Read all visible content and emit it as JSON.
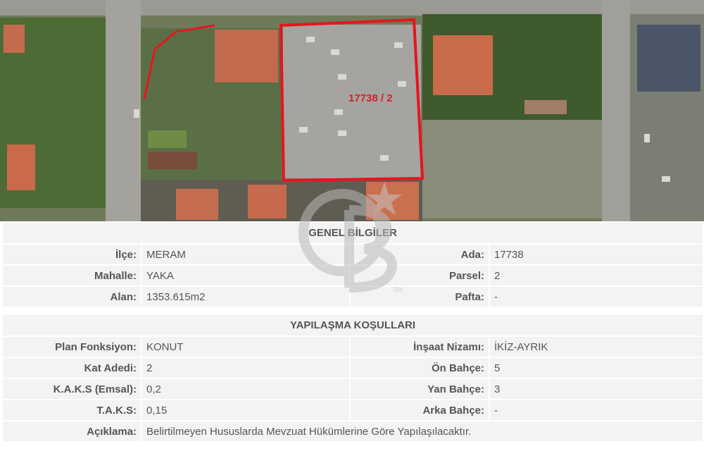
{
  "map": {
    "parcel_label": "17738 / 2",
    "boundary_color": "#e8141e"
  },
  "genel": {
    "header": "GENEL BİLGİLER",
    "rows": [
      {
        "l1": "İlçe:",
        "v1": "MERAM",
        "l2": "Ada:",
        "v2": "17738"
      },
      {
        "l1": "Mahalle:",
        "v1": "YAKA",
        "l2": "Parsel:",
        "v2": "2"
      },
      {
        "l1": "Alan:",
        "v1": "1353.615m2",
        "l2": "Pafta:",
        "v2": "-"
      }
    ]
  },
  "yapilasma": {
    "header": "YAPILAŞMA KOŞULLARI",
    "rows": [
      {
        "l1": "Plan Fonksiyon:",
        "v1": "KONUT",
        "l2": "İnşaat Nizamı:",
        "v2": "İKİZ-AYRIK"
      },
      {
        "l1": "Kat Adedi:",
        "v1": "2",
        "l2": "Ön Bahçe:",
        "v2": "5"
      },
      {
        "l1": "K.A.K.S (Emsal):",
        "v1": "0,2",
        "l2": "Yan Bahçe:",
        "v2": "3"
      },
      {
        "l1": "T.A.K.S:",
        "v1": "0,15",
        "l2": "Arka Bahçe:",
        "v2": "-"
      }
    ],
    "aciklama_label": "Açıklama:",
    "aciklama_value": "Belirtilmeyen Hususlarda Mevzuat Hükümlerine Göre Yapılaşılacaktır."
  },
  "watermark": {
    "sm": "SM"
  },
  "colors": {
    "cell_bg": "#f3f3f3",
    "text": "#555555"
  }
}
